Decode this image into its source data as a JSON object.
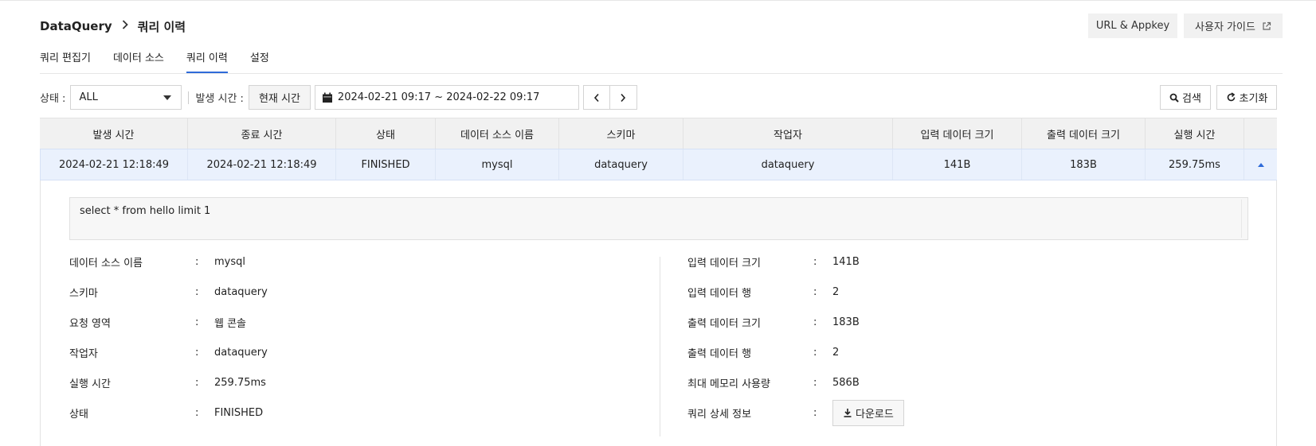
{
  "breadcrumb": {
    "root": "DataQuery",
    "current": "쿼리 이력"
  },
  "header_buttons": {
    "url_appkey": "URL & Appkey",
    "user_guide": "사용자 가이드"
  },
  "tabs": [
    {
      "label": "쿼리 편집기",
      "active": false
    },
    {
      "label": "데이터 소스",
      "active": false
    },
    {
      "label": "쿼리 이력",
      "active": true
    },
    {
      "label": "설정",
      "active": false
    }
  ],
  "filters": {
    "status_label": "상태 :",
    "status_value": "ALL",
    "time_label": "발생 시간 :",
    "now_button": "현재 시간",
    "date_range": "2024-02-21 09:17 ~ 2024-02-22 09:17",
    "search_button": "검색",
    "reset_button": "초기화"
  },
  "table": {
    "headers": [
      "발생 시간",
      "종료 시간",
      "상태",
      "데이터 소스 이름",
      "스키마",
      "작업자",
      "입력 데이터 크기",
      "출력 데이터 크기",
      "실행 시간"
    ],
    "rows": [
      [
        "2024-02-21 12:18:49",
        "2024-02-21 12:18:49",
        "FINISHED",
        "mysql",
        "dataquery",
        "dataquery",
        "141B",
        "183B",
        "259.75ms"
      ]
    ]
  },
  "detail": {
    "query": "select * from hello limit 1",
    "left": [
      {
        "key": "데이터 소스 이름",
        "value": "mysql"
      },
      {
        "key": "스키마",
        "value": "dataquery"
      },
      {
        "key": "요청 영역",
        "value": "웹 콘솔"
      },
      {
        "key": "작업자",
        "value": "dataquery"
      },
      {
        "key": "실행 시간",
        "value": "259.75ms"
      },
      {
        "key": "상태",
        "value": "FINISHED"
      }
    ],
    "right": [
      {
        "key": "입력 데이터 크기",
        "value": "141B"
      },
      {
        "key": "입력 데이터 행",
        "value": "2"
      },
      {
        "key": "출력 데이터 크기",
        "value": "183B"
      },
      {
        "key": "출력 데이터 행",
        "value": "2"
      },
      {
        "key": "최대 메모리 사용량",
        "value": "586B"
      },
      {
        "key": "쿼리 상세 정보",
        "value": ""
      }
    ],
    "colon": ":",
    "download_button": "다운로드"
  },
  "colors": {
    "accent": "#2f6bd9",
    "selected_row": "#eaf1fd",
    "header_bg": "#f1f1f1"
  }
}
